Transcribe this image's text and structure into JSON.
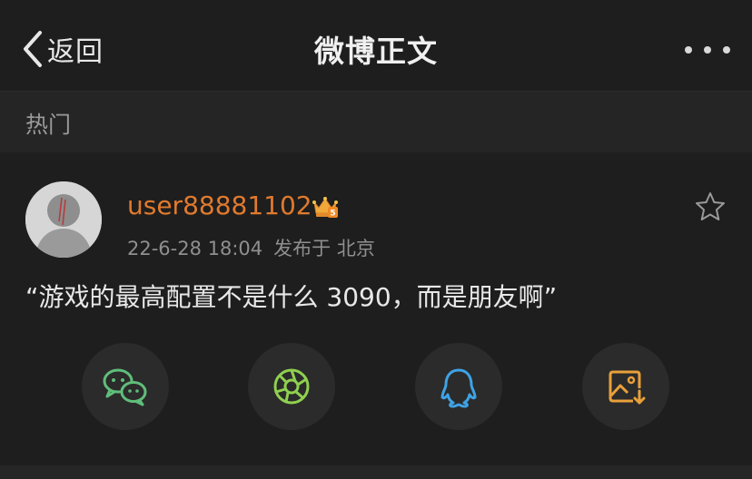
{
  "navbar": {
    "back_label": "返回",
    "title": "微博正文",
    "more_icon": "more-icon"
  },
  "section": {
    "label": "热门"
  },
  "post": {
    "username": "user88881102",
    "badge_icon": "crown-badge-icon",
    "timestamp": "22-6-28 18:04",
    "location": "发布于 北京",
    "text": "“游戏的最高配置不是什么 3090，而是朋友啊”"
  },
  "share_buttons": [
    {
      "name": "wechat-icon",
      "color": "#5fbe7a"
    },
    {
      "name": "moments-icon",
      "color": "#8fd14f"
    },
    {
      "name": "qq-icon",
      "color": "#3ea3e6"
    },
    {
      "name": "save-image-icon",
      "color": "#e9a03a"
    }
  ],
  "colors": {
    "background": "#1f1f1f",
    "username": "#e07a2e",
    "meta_text": "#8f8f8f"
  }
}
